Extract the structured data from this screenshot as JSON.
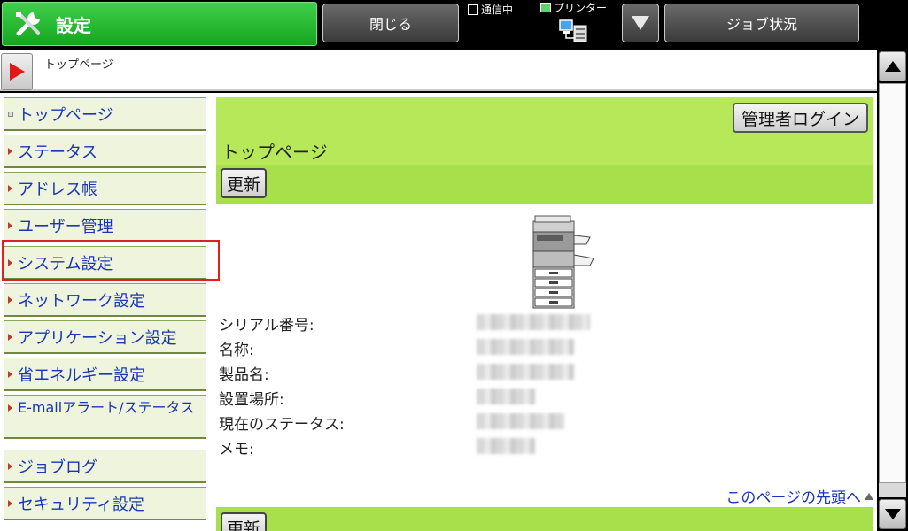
{
  "header": {
    "title": "設定",
    "title_icon": "tools-icon",
    "close_label": "閉じる",
    "comm_status": "通信中",
    "printer_status": "プリンター",
    "job_status_label": "ジョブ状況",
    "accent_color": "#16a51f"
  },
  "breadcrumb": {
    "text": "トップページ"
  },
  "sidebar": {
    "items": [
      {
        "label": "トップページ"
      },
      {
        "label": "ステータス"
      },
      {
        "label": "アドレス帳"
      },
      {
        "label": "ユーザー管理"
      },
      {
        "label": "システム設定"
      },
      {
        "label": "ネットワーク設定"
      },
      {
        "label": "アプリケーション設定"
      },
      {
        "label": "省エネルギー設定"
      },
      {
        "label": "E-mailアラート/ステータス"
      },
      {
        "label": "ジョブログ"
      },
      {
        "label": "セキュリティ設定"
      }
    ],
    "selected": "システム設定"
  },
  "content": {
    "admin_login": "管理者ログイン",
    "title": "トップページ",
    "refresh_label": "更新",
    "info": {
      "serial_label": "シリアル番号:",
      "name_label": "名称:",
      "product_label": "製品名:",
      "location_label": "設置場所:",
      "status_label": "現在のステータス:",
      "memo_label": "メモ:"
    },
    "top_link": "このページの先頭へ"
  }
}
